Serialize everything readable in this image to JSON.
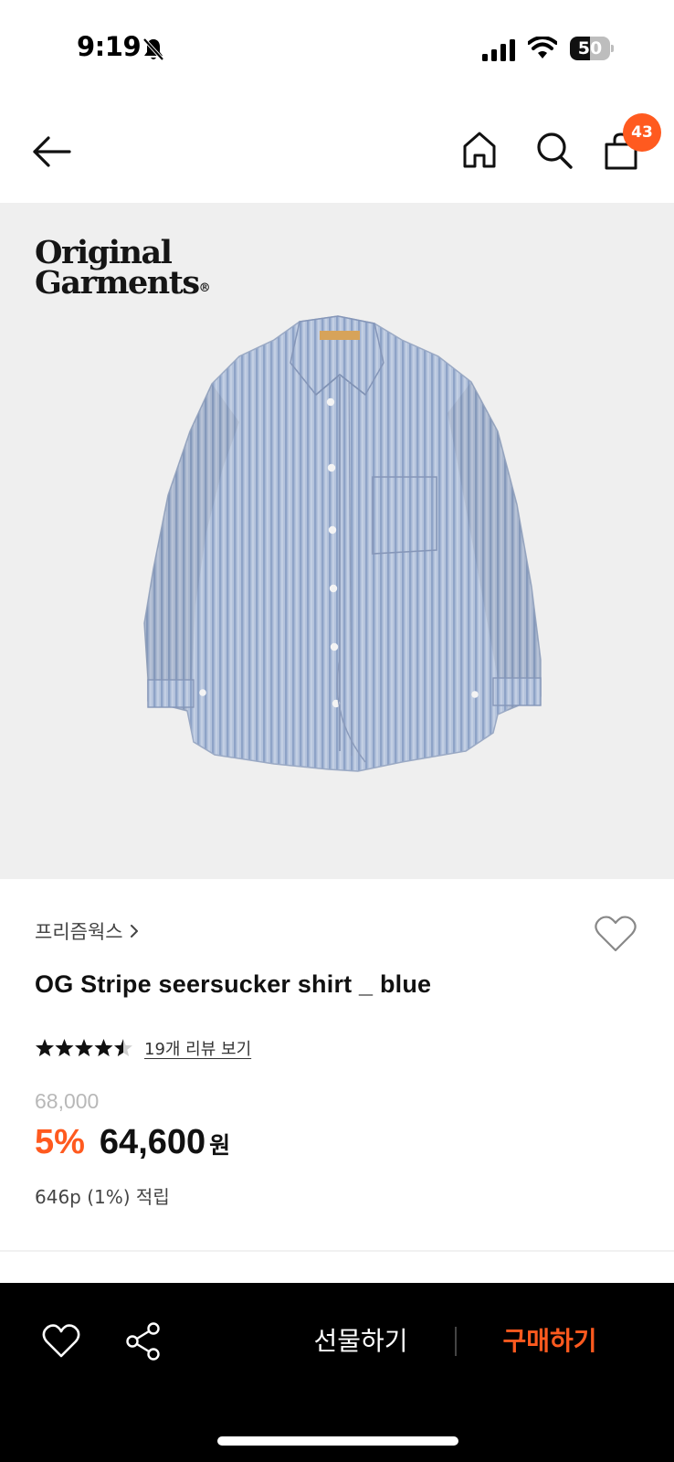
{
  "status_bar": {
    "time": "9:19",
    "battery": "50",
    "battery_level": 0.5,
    "icons": [
      "bell-slash-icon",
      "signal-icon",
      "wifi-icon",
      "battery-icon"
    ]
  },
  "nav": {
    "icons": [
      "back-arrow-icon",
      "home-icon",
      "search-icon",
      "shopping-bag-icon"
    ],
    "cart_count": "43",
    "badge_color": "#ff5a1f"
  },
  "image": {
    "brand_logo_line1": "Original",
    "brand_logo_line2": "Garments",
    "brand_logo_mark": "®",
    "background": "#efefef"
  },
  "product": {
    "brand": "프리즘웍스",
    "name": "OG Stripe seersucker shirt _ blue",
    "rating": 4.5,
    "rating_max": 5,
    "review_link": "19개 리뷰 보기",
    "original_price": "68,000",
    "discount": "5%",
    "price": "64,600",
    "currency": "원",
    "points": "646p (1%) 적립",
    "accent_color": "#ff5a1f"
  },
  "bottom_bar": {
    "gift_label": "선물하기",
    "buy_label": "구매하기",
    "icons": [
      "heart-outline-icon",
      "share-icon"
    ]
  }
}
